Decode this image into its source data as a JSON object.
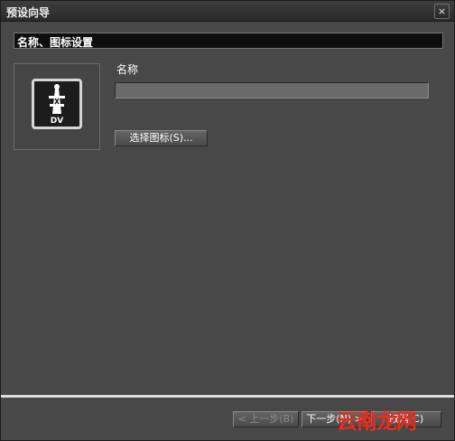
{
  "window": {
    "title": "预设向导",
    "close_glyph": "×"
  },
  "section": {
    "header": "名称、图标设置"
  },
  "icon_preview": {
    "icon": "dv-preset-icon",
    "caption": "DV"
  },
  "form": {
    "name_label": "名称",
    "name_value": "",
    "select_icon_label": "选择图标(S)..."
  },
  "footer": {
    "prev_label": "< 上一步(B)",
    "next_label": "下一步(N) >",
    "cancel_label": "取消(C)"
  },
  "watermark": {
    "text": "云南龙网"
  },
  "colors": {
    "background": "#484848",
    "header_bar": "#0e0e0e",
    "separator": "#dcdcdc",
    "watermark": "#ee2a1a"
  }
}
